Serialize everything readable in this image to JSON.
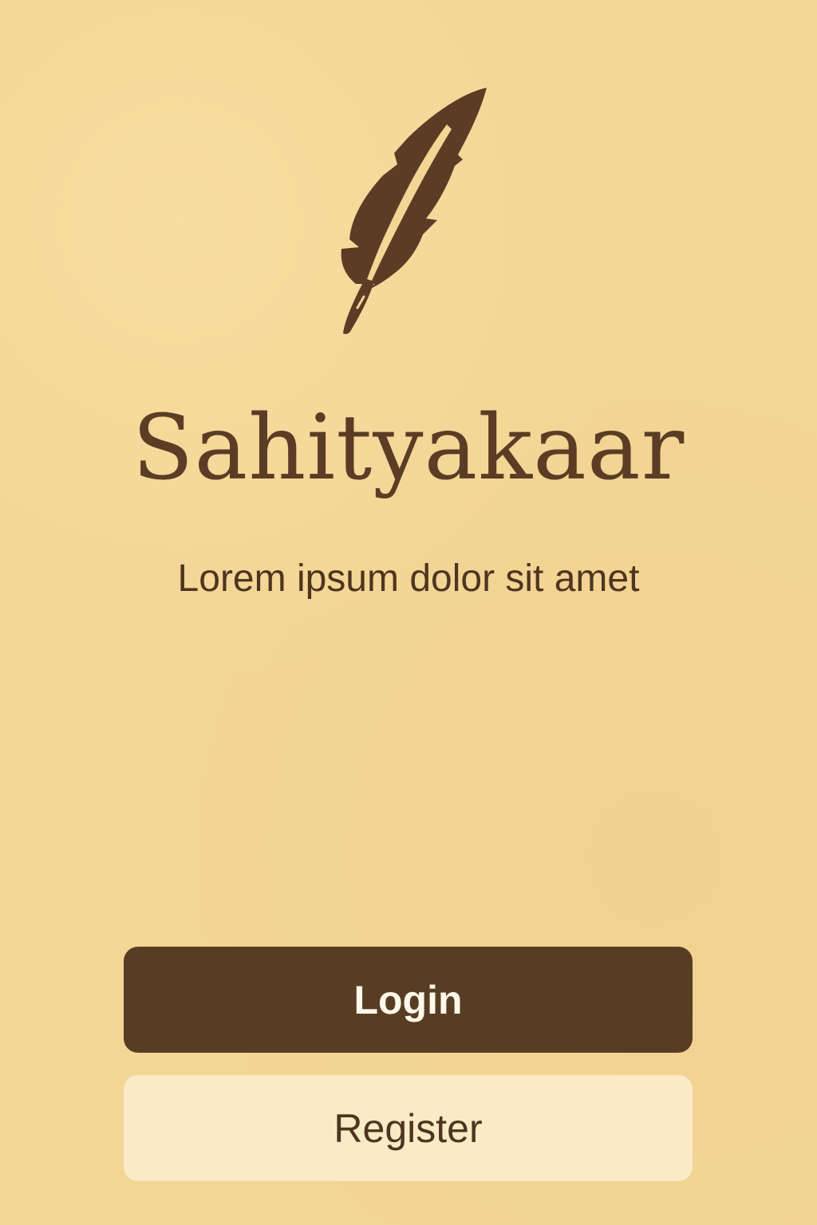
{
  "app": {
    "title": "Sahityakaar",
    "tagline": "Lorem ipsum dolor sit amet",
    "logo_icon": "quill-feather-icon"
  },
  "actions": {
    "login_label": "Login",
    "register_label": "Register"
  },
  "colors": {
    "background": "#f3d595",
    "brand_brown": "#583d25",
    "text_brown": "#4e3520",
    "register_bg": "#faeac6",
    "login_text": "#fff8ea"
  }
}
